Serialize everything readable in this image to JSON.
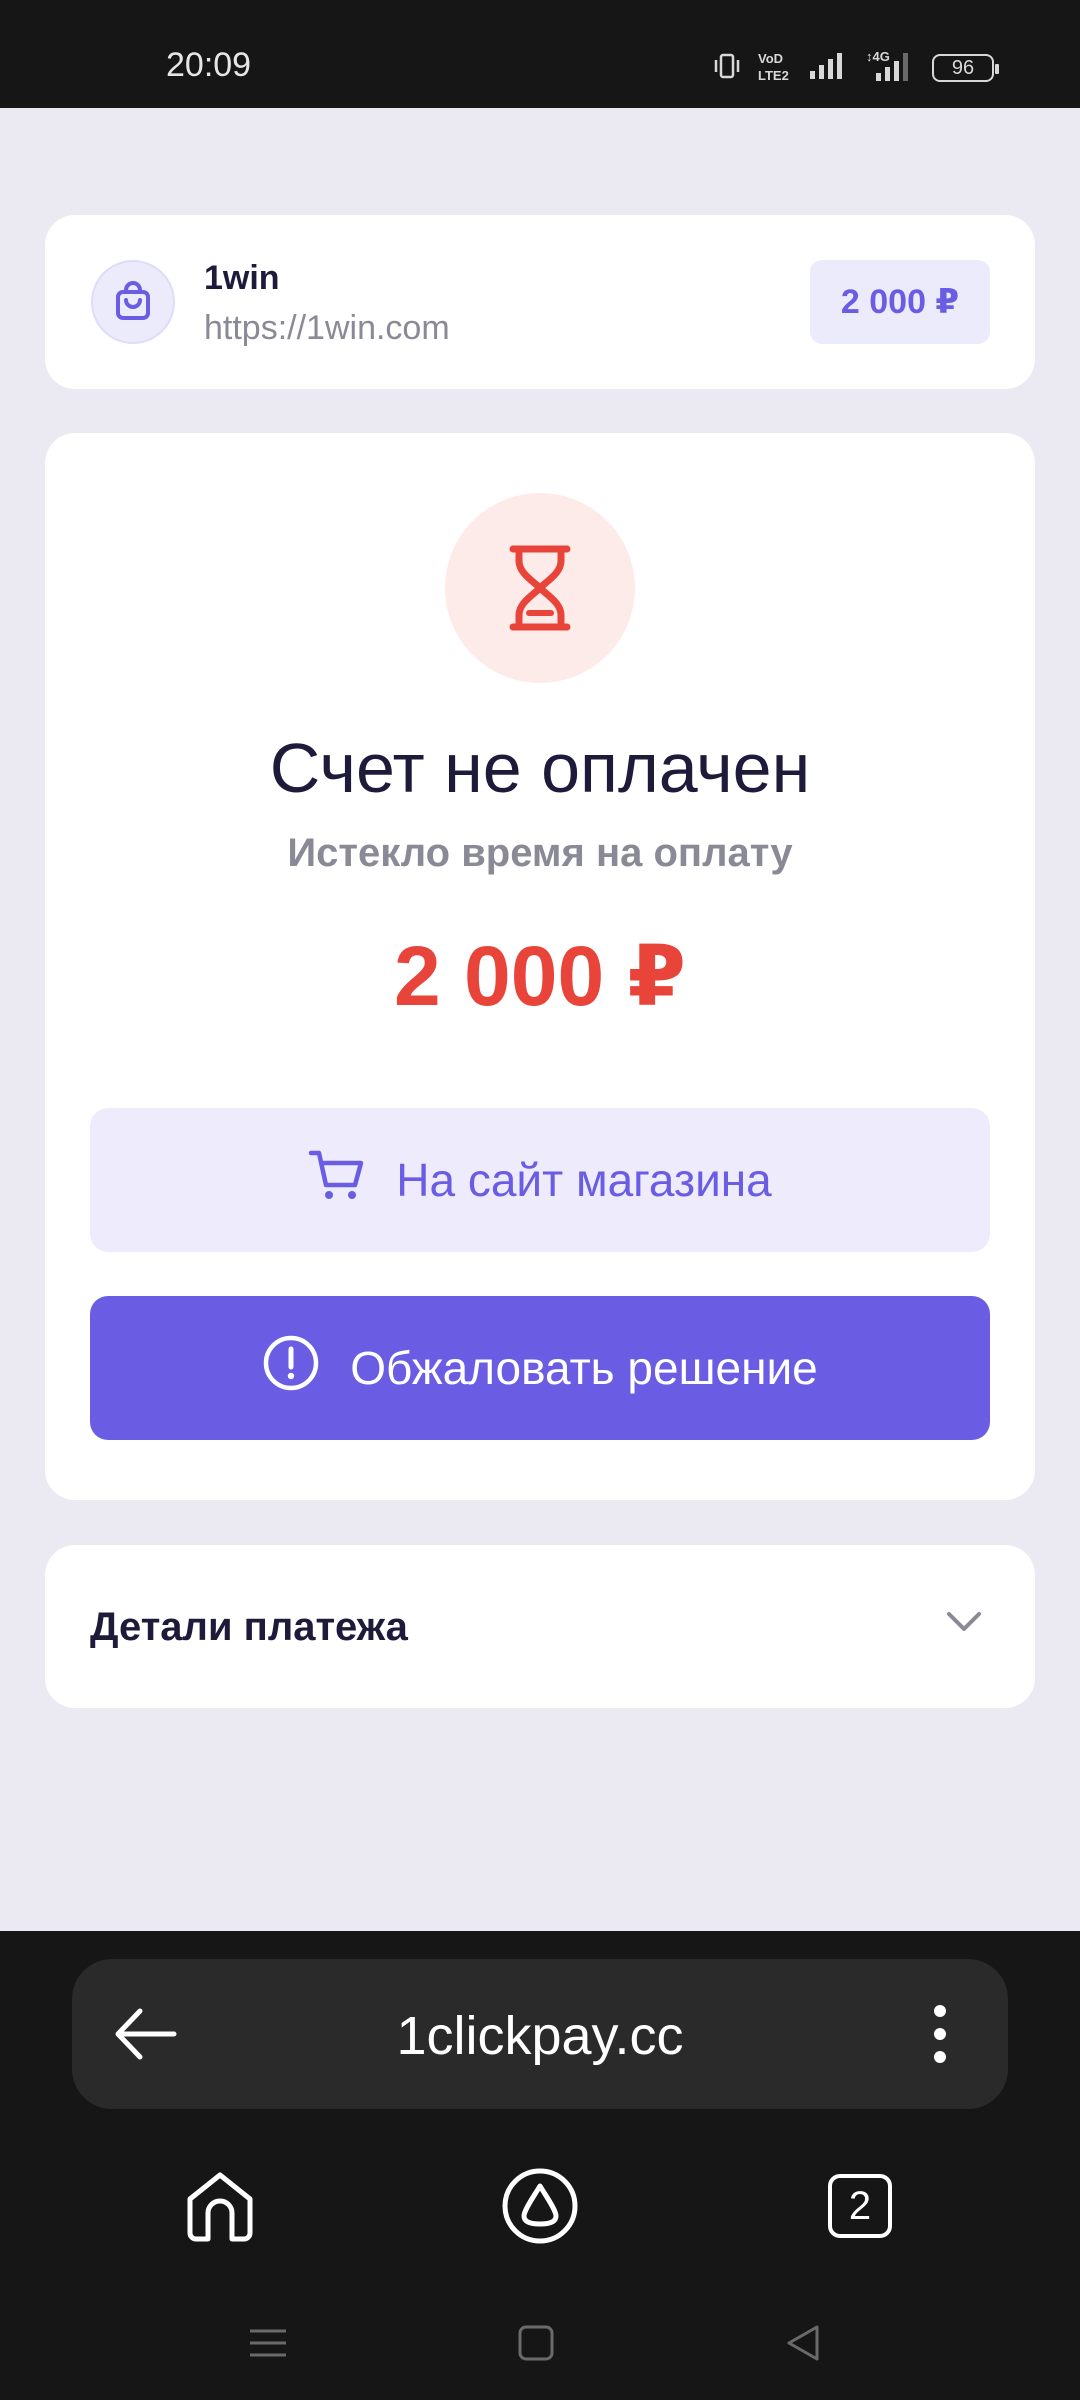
{
  "status_bar": {
    "time": "20:09",
    "battery": "96",
    "icons": [
      "vibrate-icon",
      "volte-icon",
      "signal-icon",
      "4g-signal-icon",
      "battery-icon"
    ]
  },
  "merchant": {
    "name": "1win",
    "url": "https://1win.com",
    "amount": "2 000 ₽",
    "icon": "shopping-bag-icon"
  },
  "payment_status": {
    "icon": "hourglass-icon",
    "title": "Счет не оплачен",
    "subtitle": "Истекло время на оплату",
    "amount": "2 000 ₽"
  },
  "actions": {
    "store_button": {
      "label": "На сайт магазина",
      "icon": "cart-icon"
    },
    "appeal_button": {
      "label": "Обжаловать решение",
      "icon": "alert-circle-icon"
    }
  },
  "details": {
    "label": "Детали платежа",
    "icon": "chevron-down-icon"
  },
  "browser": {
    "address": "1clickpay.cc",
    "tabs_count": "2"
  },
  "colors": {
    "accent": "#6b5ce4",
    "error": "#e8443a",
    "text_primary": "#1e1a3a",
    "text_muted": "#8a8996",
    "page_bg": "#ebeaf2"
  }
}
